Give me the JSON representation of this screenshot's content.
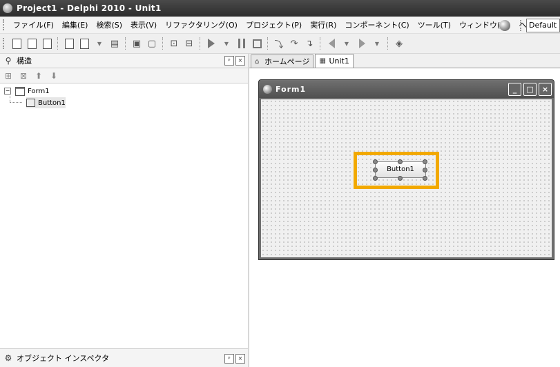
{
  "window": {
    "title": "Project1 - Delphi 2010 - Unit1"
  },
  "menu": {
    "items": [
      "ファイル(F)",
      "編集(E)",
      "検索(S)",
      "表示(V)",
      "リファクタリング(O)",
      "プロジェクト(P)",
      "実行(R)",
      "コンポーネント(C)",
      "ツール(T)",
      "ウィンドウ(W)",
      "ヘルプ(H)"
    ],
    "layout_value": "Default L"
  },
  "structure_panel": {
    "title": "構造",
    "pin_label": "ᵖ",
    "close_label": "×",
    "tree": [
      {
        "label": "Form1",
        "expander": "−"
      },
      {
        "label": "Button1"
      }
    ]
  },
  "object_inspector": {
    "title": "オブジェクト インスペクタ",
    "pin_label": "ᵖ",
    "close_label": "×"
  },
  "tabs": [
    {
      "label": "ホームページ",
      "active": false
    },
    {
      "label": "Unit1",
      "active": true
    }
  ],
  "form_designer": {
    "form_caption": "Form1",
    "minimize_label": "_",
    "maximize_label": "□",
    "close_label": "×",
    "button_caption": "Button1",
    "highlight_color": "#f2a900"
  }
}
